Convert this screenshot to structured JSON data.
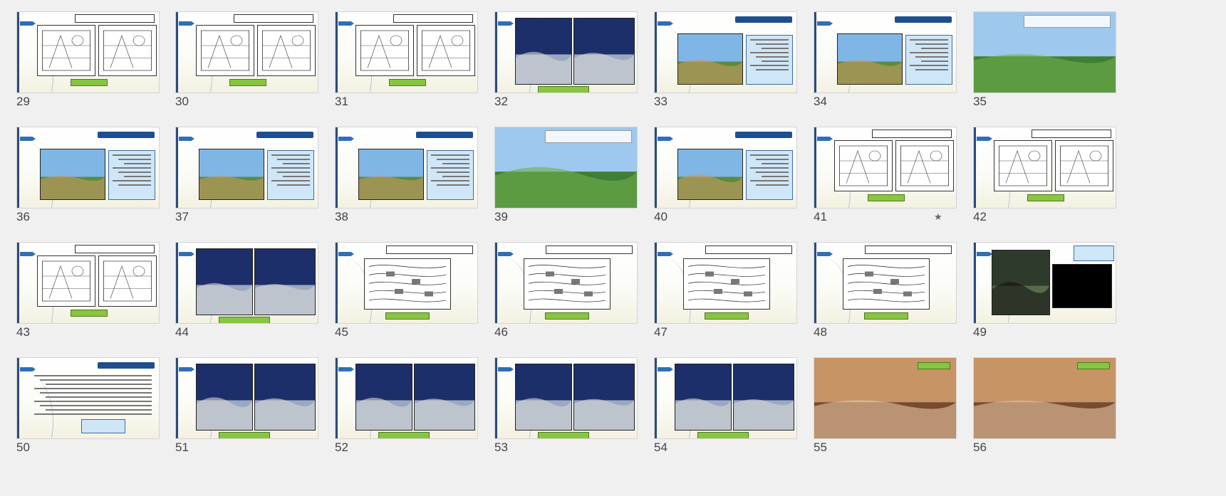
{
  "view": "slide-sorter",
  "accent_colors": {
    "slide_bar": "#2c4a7e",
    "title_bar": "#1d4e8f",
    "label_green": "#88c540",
    "textbox_blue": "#cfe6f7"
  },
  "slides": [
    {
      "number": "29",
      "kind": "diagram"
    },
    {
      "number": "30",
      "kind": "sketches"
    },
    {
      "number": "31",
      "kind": "sections"
    },
    {
      "number": "32",
      "kind": "buildings"
    },
    {
      "number": "33",
      "kind": "photo-text"
    },
    {
      "number": "34",
      "kind": "photo-text"
    },
    {
      "number": "35",
      "kind": "landscape"
    },
    {
      "number": "36",
      "kind": "photo-text"
    },
    {
      "number": "37",
      "kind": "photo-text"
    },
    {
      "number": "38",
      "kind": "photo-text"
    },
    {
      "number": "39",
      "kind": "landscape"
    },
    {
      "number": "40",
      "kind": "photo-text"
    },
    {
      "number": "41",
      "kind": "diagram",
      "starred": true,
      "star_icon": "star-icon"
    },
    {
      "number": "42",
      "kind": "diagram"
    },
    {
      "number": "43",
      "kind": "sections"
    },
    {
      "number": "44",
      "kind": "buildings"
    },
    {
      "number": "45",
      "kind": "windflow"
    },
    {
      "number": "46",
      "kind": "windflow"
    },
    {
      "number": "47",
      "kind": "windflow"
    },
    {
      "number": "48",
      "kind": "windflow"
    },
    {
      "number": "49",
      "kind": "map"
    },
    {
      "number": "50",
      "kind": "text"
    },
    {
      "number": "51",
      "kind": "buildings"
    },
    {
      "number": "52",
      "kind": "buildings"
    },
    {
      "number": "53",
      "kind": "buildings"
    },
    {
      "number": "54",
      "kind": "buildings"
    },
    {
      "number": "55",
      "kind": "render"
    },
    {
      "number": "56",
      "kind": "render"
    }
  ]
}
